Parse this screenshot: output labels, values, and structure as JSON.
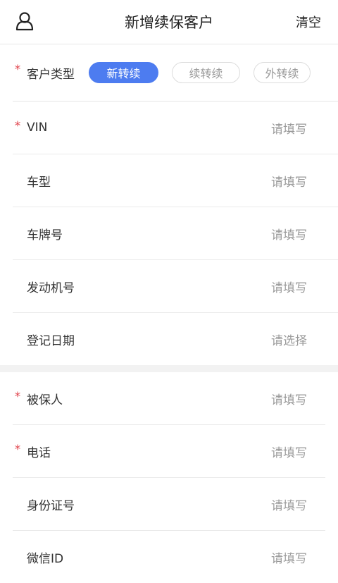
{
  "header": {
    "title": "新增续保客户",
    "clear_label": "清空"
  },
  "customer_type": {
    "label": "客户类型",
    "required": true,
    "options": [
      {
        "label": "新转续",
        "active": true
      },
      {
        "label": "续转续",
        "active": false
      },
      {
        "label": "外转续",
        "active": false
      }
    ]
  },
  "vehicle_fields": [
    {
      "label": "VIN",
      "placeholder": "请填写",
      "required": true
    },
    {
      "label": "车型",
      "placeholder": "请填写",
      "required": false
    },
    {
      "label": "车牌号",
      "placeholder": "请填写",
      "required": false
    },
    {
      "label": "发动机号",
      "placeholder": "请填写",
      "required": false
    },
    {
      "label": "登记日期",
      "placeholder": "请选择",
      "required": false
    }
  ],
  "insured_fields": [
    {
      "label": "被保人",
      "placeholder": "请填写",
      "required": true
    },
    {
      "label": "电话",
      "placeholder": "请填写",
      "required": true
    },
    {
      "label": "身份证号",
      "placeholder": "请填写",
      "required": false
    },
    {
      "label": "微信ID",
      "placeholder": "请填写",
      "required": false
    }
  ],
  "required_mark": "*",
  "colors": {
    "accent": "#4d7cf0",
    "required": "#e0424b",
    "placeholder": "#9a9a9a"
  }
}
